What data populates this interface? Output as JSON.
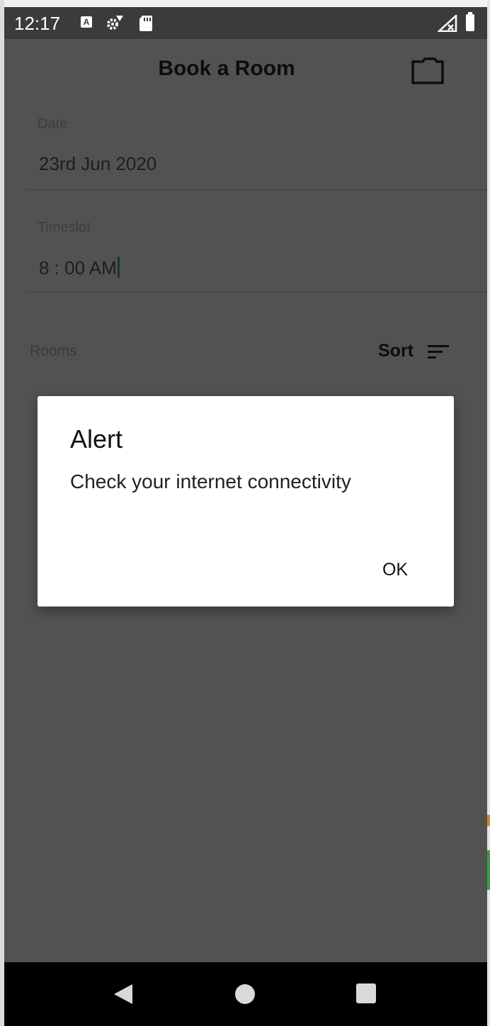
{
  "status_bar": {
    "time": "12:17"
  },
  "app_bar": {
    "title": "Book a Room",
    "action_icon": "folder-icon"
  },
  "form": {
    "date": {
      "label": "Date",
      "value": "23rd Jun 2020"
    },
    "timeslot": {
      "label": "Timeslot",
      "value": "8 : 00 AM"
    }
  },
  "rooms": {
    "label": "Rooms",
    "sort_label": "Sort",
    "sort_icon": "sort-icon"
  },
  "dialog": {
    "title": "Alert",
    "message": "Check your internet connectivity",
    "ok_label": "OK"
  },
  "nav_bar": {
    "icons": [
      "back-icon",
      "home-icon",
      "recents-icon"
    ]
  },
  "colors": {
    "scrim": "#525252",
    "status_bar": "#3b3b3b",
    "dialog_bg": "#ffffff",
    "nav_bar": "#000000"
  }
}
